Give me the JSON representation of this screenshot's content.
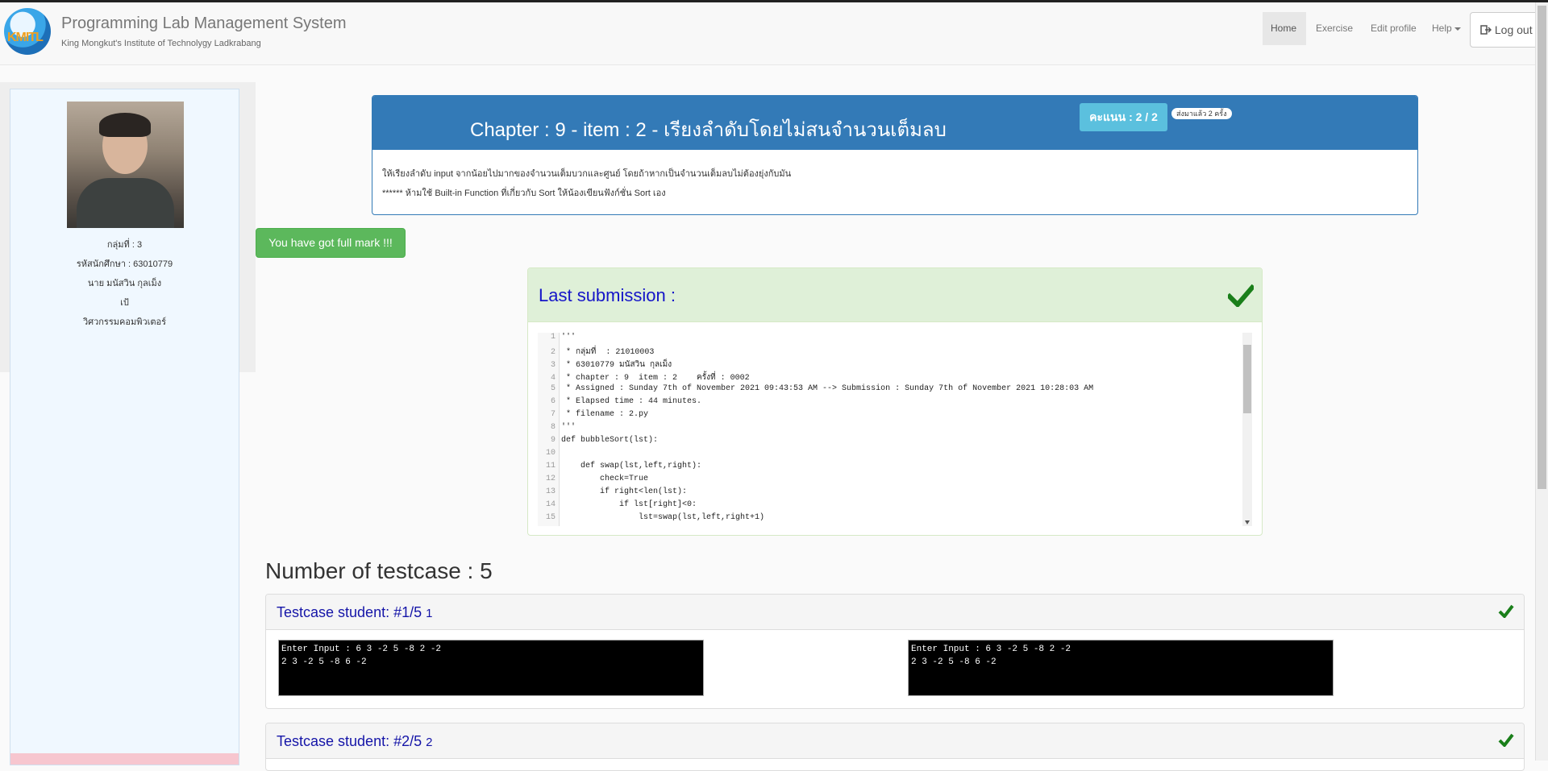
{
  "brand": {
    "logo_text": "KMITL",
    "title": "Programming Lab Management System",
    "subtitle": "King Mongkut's Institute of Technolygy Ladkrabang"
  },
  "nav": {
    "home": "Home",
    "exercise": "Exercise",
    "edit_profile": "Edit profile",
    "help": "Help",
    "logout": "Log out"
  },
  "student": {
    "group": "กลุ่มที่ : 3",
    "student_id": "รหัสนักศึกษา : 63010779",
    "name": "นาย มนัสวิน กุลเม็ง",
    "nickname": "เป้",
    "faculty": "วิศวกรรมคอมพิวเตอร์"
  },
  "chapter": {
    "title": "Chapter : 9 - item : 2 - เรียงลำดับโดยไม่สนจำนวนเต็มลบ",
    "score": "คะแนน : 2 / 2",
    "sent": "ส่งมาแล้ว 2 ครั้ง",
    "desc1": "ให้เรียงลำดับ input จากน้อยไปมากของจำนวนเต็มบวกและศูนย์ โดยถ้าหากเป็นจำนวนเต็มลบไม่ต้องยุ่งกับมัน",
    "desc2": "****** ห้ามใช้ Built-in Function ที่เกี่ยวกับ Sort ให้น้องเขียนฟังก์ชั่น Sort เอง"
  },
  "full_mark": "You have got full mark !!!",
  "last_submission": {
    "title": "Last submission :",
    "lines": [
      "'''",
      " * กลุ่มที่  : 21010003",
      " * 63010779 มนัสวิน กุลเม็ง",
      " * chapter : 9  item : 2    ครั้งที่ : 0002",
      " * Assigned : Sunday 7th of November 2021 09:43:53 AM --> Submission : Sunday 7th of November 2021 10:28:03 AM",
      " * Elapsed time : 44 minutes.",
      " * filename : 2.py",
      "'''",
      "def bubbleSort(lst):",
      "",
      "    def swap(lst,left,right):",
      "        check=True",
      "        if right<len(lst):",
      "            if lst[right]<0:",
      "                lst=swap(lst,left,right+1)"
    ]
  },
  "number_of_testcase": "Number of testcase : 5",
  "testcases": [
    {
      "title": "Testcase student: #1/5",
      "num": "1",
      "student_output": "Enter Input : 6 3 -2 5 -8 2 -2\n2 3 -2 5 -8 6 -2",
      "expected_output": "Enter Input : 6 3 -2 5 -8 2 -2\n2 3 -2 5 -8 6 -2"
    },
    {
      "title": "Testcase student: #2/5",
      "num": "2"
    }
  ],
  "colors": {
    "primary": "#337ab7",
    "info": "#5bc0de",
    "success": "#5cb85c",
    "check": "#1a7f1a"
  },
  "icons": {
    "logout": "sign-out-icon",
    "check": "check-icon"
  }
}
